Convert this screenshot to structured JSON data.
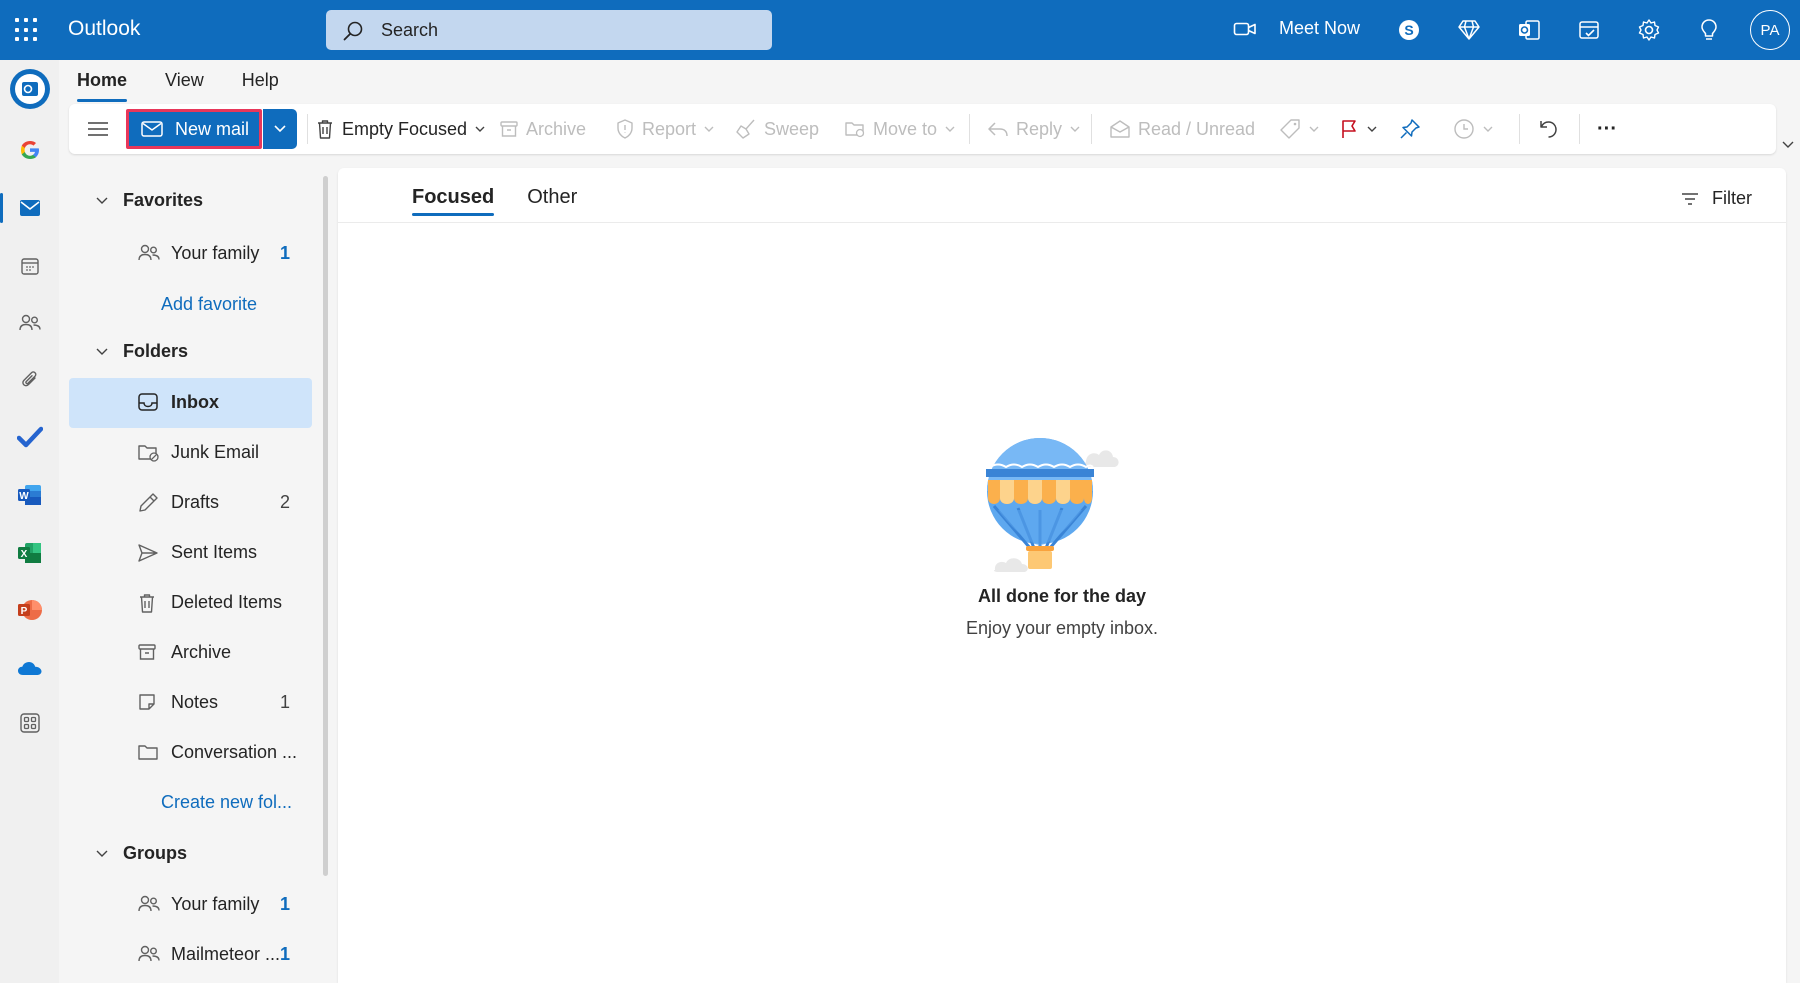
{
  "app": {
    "name": "Outlook"
  },
  "search": {
    "placeholder": "Search"
  },
  "header": {
    "meet_now": "Meet Now",
    "avatar_initials": "PA"
  },
  "ribbon_tabs": [
    {
      "label": "Home",
      "active": true
    },
    {
      "label": "View",
      "active": false
    },
    {
      "label": "Help",
      "active": false
    }
  ],
  "toolbar": {
    "new_mail": "New mail",
    "empty_focused": "Empty Focused",
    "archive": "Archive",
    "report": "Report",
    "sweep": "Sweep",
    "move_to": "Move to",
    "reply": "Reply",
    "read_unread": "Read / Unread",
    "more": "···"
  },
  "folders": {
    "favorites_heading": "Favorites",
    "favorites": [
      {
        "label": "Your family",
        "count": "1",
        "icon": "people-icon"
      }
    ],
    "add_favorite": "Add favorite",
    "folders_heading": "Folders",
    "items": [
      {
        "label": "Inbox",
        "count": "",
        "icon": "inbox-icon",
        "selected": true
      },
      {
        "label": "Junk Email",
        "count": "",
        "icon": "junk-icon"
      },
      {
        "label": "Drafts",
        "count": "2",
        "icon": "drafts-icon"
      },
      {
        "label": "Sent Items",
        "count": "",
        "icon": "send-icon"
      },
      {
        "label": "Deleted Items",
        "count": "",
        "icon": "trash-icon"
      },
      {
        "label": "Archive",
        "count": "",
        "icon": "archive-icon"
      },
      {
        "label": "Notes",
        "count": "1",
        "icon": "note-icon"
      },
      {
        "label": "Conversation ...",
        "count": "",
        "icon": "folder-icon"
      }
    ],
    "create_new_folder": "Create new fol...",
    "groups_heading": "Groups",
    "groups": [
      {
        "label": "Your family",
        "count": "1",
        "icon": "people-icon"
      },
      {
        "label": "Mailmeteor ...",
        "count": "1",
        "icon": "people-icon"
      }
    ]
  },
  "mail_list": {
    "tabs": [
      {
        "label": "Focused",
        "active": true
      },
      {
        "label": "Other",
        "active": false
      }
    ],
    "filter": "Filter",
    "empty_title": "All done for the day",
    "empty_subtitle": "Enjoy your empty inbox."
  },
  "colors": {
    "accent": "#0f6cbd",
    "highlight_border": "#e8375a",
    "selected_folder": "#cfe4fa"
  }
}
